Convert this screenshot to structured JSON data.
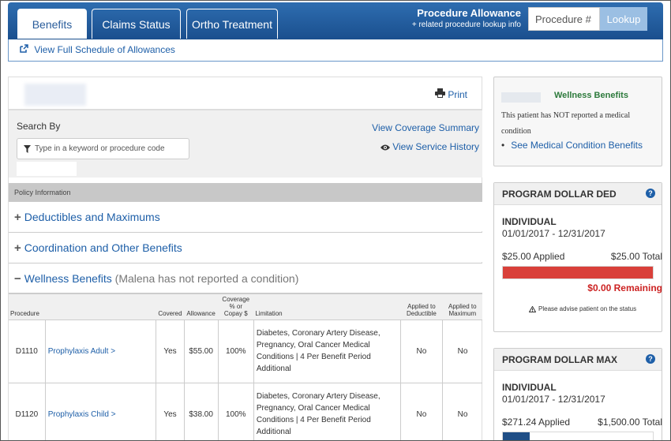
{
  "header": {
    "tabs": [
      {
        "label": "Benefits",
        "active": true
      },
      {
        "label": "Claims Status",
        "active": false
      },
      {
        "label": "Ortho Treatment",
        "active": false
      }
    ],
    "procedure_title": "Procedure Allowance",
    "procedure_subtitle": "+ related procedure lookup info",
    "procedure_placeholder": "Procedure #",
    "lookup_label": "Lookup"
  },
  "schedule_link": "View Full Schedule of Allowances",
  "main": {
    "print_label": "Print",
    "search_by_label": "Search By",
    "search_placeholder": "Type in a keyword or procedure code",
    "view_coverage_summary": "View Coverage Summary",
    "view_service_history": "View Service History",
    "policy_info_label": "Policy Information",
    "sections": [
      {
        "sign": "+",
        "label": "Deductibles and Maximums",
        "note": ""
      },
      {
        "sign": "+",
        "label": "Coordination and Other Benefits",
        "note": ""
      },
      {
        "sign": "−",
        "label": "Wellness Benefits",
        "note": " (Malena has not reported a condition)"
      }
    ],
    "table": {
      "headers": {
        "procedure": "Procedure",
        "covered": "Covered",
        "allowance": "Allowance",
        "coverage": "Coverage % or Copay $",
        "limitation": "Limitation",
        "applied_deductible": "Applied to Deductible",
        "applied_maximum": "Applied to Maximum"
      },
      "rows": [
        {
          "code": "D1110",
          "name": "Prophylaxis Adult >",
          "covered": "Yes",
          "allowance": "$55.00",
          "coverage": "100%",
          "limitation": "Diabetes, Coronary Artery Disease, Pregnancy, Oral Cancer Medical Conditions | 4 Per Benefit Period Additional",
          "deductible": "No",
          "maximum": "No"
        },
        {
          "code": "D1120",
          "name": "Prophylaxis Child >",
          "covered": "Yes",
          "allowance": "$38.00",
          "coverage": "100%",
          "limitation": "Diabetes, Coronary Artery Disease, Pregnancy, Oral Cancer Medical Conditions | 4 Per Benefit Period Additional",
          "deductible": "No",
          "maximum": "No"
        }
      ]
    }
  },
  "wellness_card": {
    "title": "Wellness Benefits",
    "text": "This patient has NOT reported a medical condition",
    "link": "See Medical Condition Benefits"
  },
  "deductible_card": {
    "title": "PROGRAM DOLLAR DED",
    "help": "?",
    "level": "INDIVIDUAL",
    "dates": "01/01/2017 - 12/31/2017",
    "applied": "$25.00 Applied",
    "total": "$25.00 Total",
    "applied_fraction": 1.0,
    "bar_color": "#d9403a",
    "remaining": "$0.00 Remaining",
    "advise": "Please advise patient on the status"
  },
  "maximum_card": {
    "title": "PROGRAM DOLLAR MAX",
    "help": "?",
    "level": "INDIVIDUAL",
    "dates": "01/01/2017 - 12/31/2017",
    "applied": "$271.24 Applied",
    "total": "$1,500.00 Total",
    "applied_fraction": 0.18,
    "bar_color": "#1f4e86"
  }
}
